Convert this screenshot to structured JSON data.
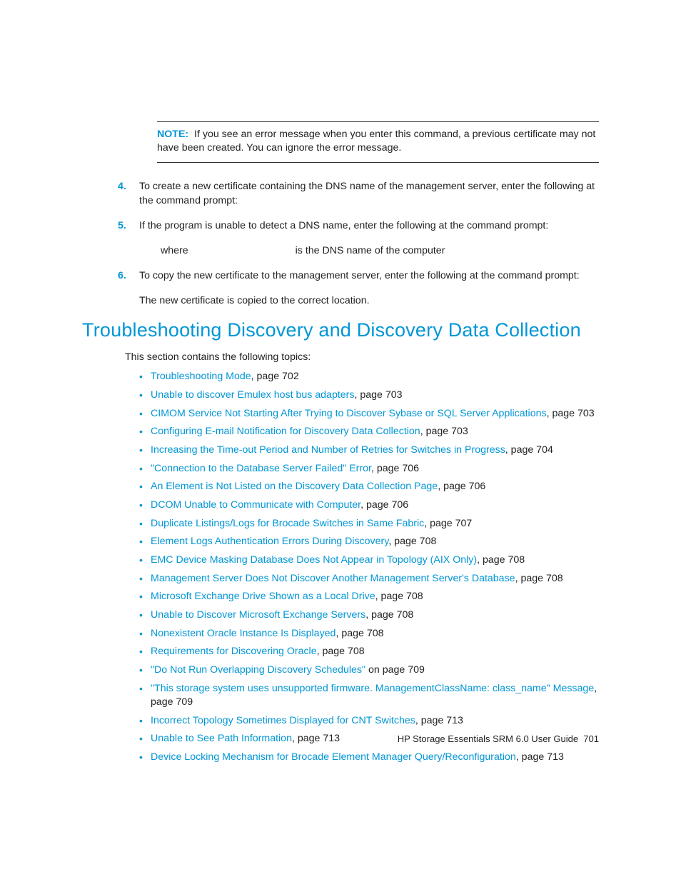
{
  "note": {
    "label": "NOTE:",
    "text": "If you see an error message when you enter this command, a previous certificate may not have been created. You can ignore the error message."
  },
  "steps": [
    {
      "num": "4.",
      "text": "To create a new certificate containing the DNS name of the management server, enter the following at the command prompt:"
    },
    {
      "num": "5.",
      "text": "If the program is unable to detect a DNS name, enter the following at the command prompt:"
    },
    {
      "num": "6.",
      "text": "To copy the new certificate to the management server, enter the following at the command prompt:"
    }
  ],
  "where": {
    "prefix": "where",
    "suffix": "is the DNS name of the computer"
  },
  "post_step": "The new certificate is copied to the correct location.",
  "heading": "Troubleshooting Discovery and Discovery Data Collection",
  "intro": "This section contains the following topics:",
  "topics": [
    {
      "link": "Troubleshooting Mode",
      "suffix": ", page 702"
    },
    {
      "link": "Unable to discover Emulex host bus adapters",
      "suffix": ", page 703"
    },
    {
      "link": "CIMOM Service Not Starting After Trying to Discover Sybase or SQL Server Applications",
      "suffix": ", page 703"
    },
    {
      "link": "Configuring E-mail Notification for Discovery Data Collection",
      "suffix": ", page 703"
    },
    {
      "link": "Increasing the Time-out Period and Number of Retries for Switches in Progress",
      "suffix": ", page 704"
    },
    {
      "link": "\"Connection to the Database Server Failed\" Error",
      "suffix": ", page 706"
    },
    {
      "link": "An Element is Not Listed on the Discovery Data Collection Page",
      "suffix": ", page 706"
    },
    {
      "link": "DCOM Unable to Communicate with Computer",
      "suffix": ", page 706"
    },
    {
      "link": "Duplicate Listings/Logs for Brocade Switches in Same Fabric",
      "suffix": ", page 707"
    },
    {
      "link": "Element Logs Authentication Errors During Discovery",
      "suffix": ", page 708"
    },
    {
      "link": "EMC Device Masking Database Does Not Appear in Topology (AIX Only)",
      "suffix": ", page 708"
    },
    {
      "link": "Management Server Does Not Discover Another Management Server's Database",
      "suffix": ", page 708"
    },
    {
      "link": "Microsoft Exchange Drive Shown as a Local Drive",
      "suffix": ", page 708"
    },
    {
      "link": "Unable to Discover Microsoft Exchange Servers",
      "suffix": ", page 708"
    },
    {
      "link": "Nonexistent Oracle Instance Is Displayed",
      "suffix": ", page 708"
    },
    {
      "link": "Requirements for Discovering Oracle",
      "suffix": ", page 708"
    },
    {
      "link": "\"Do Not Run Overlapping Discovery Schedules\"",
      "suffix": " on page 709"
    },
    {
      "link": "\"This storage system uses unsupported firmware. ManagementClassName: class_name\" Message",
      "suffix": ", page 709"
    },
    {
      "link": "Incorrect Topology Sometimes Displayed for CNT Switches",
      "suffix": ", page 713"
    },
    {
      "link": "Unable to See Path Information",
      "suffix": ", page 713"
    },
    {
      "link": "Device Locking Mechanism for Brocade Element Manager Query/Reconfiguration",
      "suffix": ", page 713"
    }
  ],
  "footer": {
    "title": "HP Storage Essentials SRM 6.0 User Guide",
    "page": "701"
  }
}
